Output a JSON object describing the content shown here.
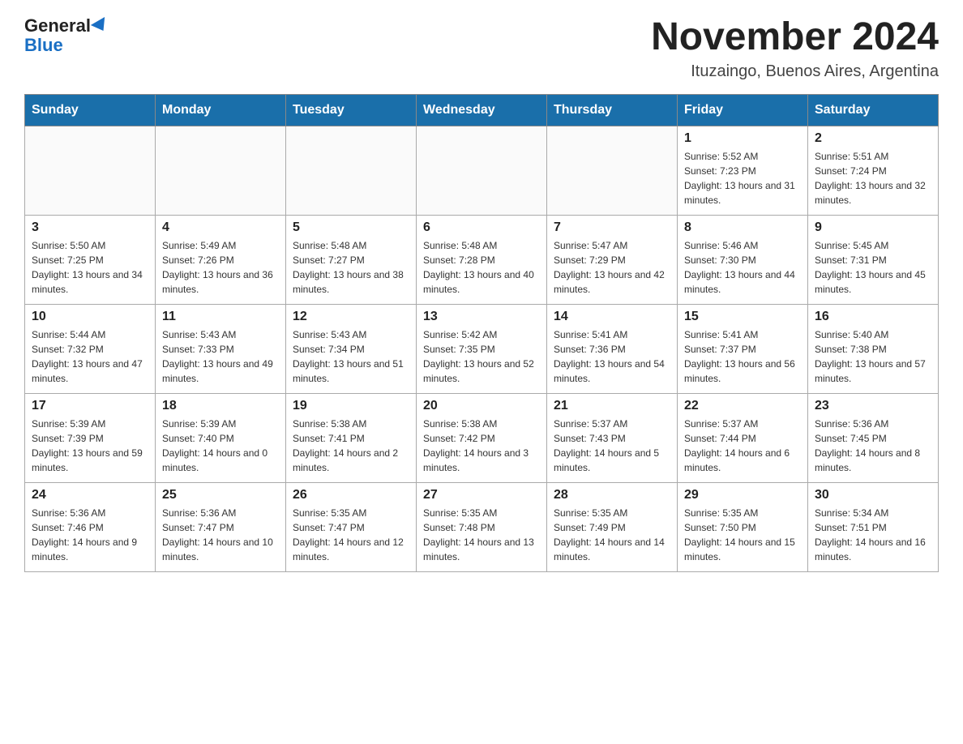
{
  "header": {
    "logo_general": "General",
    "logo_blue": "Blue",
    "title": "November 2024",
    "subtitle": "Ituzaingo, Buenos Aires, Argentina"
  },
  "weekdays": [
    "Sunday",
    "Monday",
    "Tuesday",
    "Wednesday",
    "Thursday",
    "Friday",
    "Saturday"
  ],
  "weeks": [
    [
      {
        "day": "",
        "info": ""
      },
      {
        "day": "",
        "info": ""
      },
      {
        "day": "",
        "info": ""
      },
      {
        "day": "",
        "info": ""
      },
      {
        "day": "",
        "info": ""
      },
      {
        "day": "1",
        "info": "Sunrise: 5:52 AM\nSunset: 7:23 PM\nDaylight: 13 hours and 31 minutes."
      },
      {
        "day": "2",
        "info": "Sunrise: 5:51 AM\nSunset: 7:24 PM\nDaylight: 13 hours and 32 minutes."
      }
    ],
    [
      {
        "day": "3",
        "info": "Sunrise: 5:50 AM\nSunset: 7:25 PM\nDaylight: 13 hours and 34 minutes."
      },
      {
        "day": "4",
        "info": "Sunrise: 5:49 AM\nSunset: 7:26 PM\nDaylight: 13 hours and 36 minutes."
      },
      {
        "day": "5",
        "info": "Sunrise: 5:48 AM\nSunset: 7:27 PM\nDaylight: 13 hours and 38 minutes."
      },
      {
        "day": "6",
        "info": "Sunrise: 5:48 AM\nSunset: 7:28 PM\nDaylight: 13 hours and 40 minutes."
      },
      {
        "day": "7",
        "info": "Sunrise: 5:47 AM\nSunset: 7:29 PM\nDaylight: 13 hours and 42 minutes."
      },
      {
        "day": "8",
        "info": "Sunrise: 5:46 AM\nSunset: 7:30 PM\nDaylight: 13 hours and 44 minutes."
      },
      {
        "day": "9",
        "info": "Sunrise: 5:45 AM\nSunset: 7:31 PM\nDaylight: 13 hours and 45 minutes."
      }
    ],
    [
      {
        "day": "10",
        "info": "Sunrise: 5:44 AM\nSunset: 7:32 PM\nDaylight: 13 hours and 47 minutes."
      },
      {
        "day": "11",
        "info": "Sunrise: 5:43 AM\nSunset: 7:33 PM\nDaylight: 13 hours and 49 minutes."
      },
      {
        "day": "12",
        "info": "Sunrise: 5:43 AM\nSunset: 7:34 PM\nDaylight: 13 hours and 51 minutes."
      },
      {
        "day": "13",
        "info": "Sunrise: 5:42 AM\nSunset: 7:35 PM\nDaylight: 13 hours and 52 minutes."
      },
      {
        "day": "14",
        "info": "Sunrise: 5:41 AM\nSunset: 7:36 PM\nDaylight: 13 hours and 54 minutes."
      },
      {
        "day": "15",
        "info": "Sunrise: 5:41 AM\nSunset: 7:37 PM\nDaylight: 13 hours and 56 minutes."
      },
      {
        "day": "16",
        "info": "Sunrise: 5:40 AM\nSunset: 7:38 PM\nDaylight: 13 hours and 57 minutes."
      }
    ],
    [
      {
        "day": "17",
        "info": "Sunrise: 5:39 AM\nSunset: 7:39 PM\nDaylight: 13 hours and 59 minutes."
      },
      {
        "day": "18",
        "info": "Sunrise: 5:39 AM\nSunset: 7:40 PM\nDaylight: 14 hours and 0 minutes."
      },
      {
        "day": "19",
        "info": "Sunrise: 5:38 AM\nSunset: 7:41 PM\nDaylight: 14 hours and 2 minutes."
      },
      {
        "day": "20",
        "info": "Sunrise: 5:38 AM\nSunset: 7:42 PM\nDaylight: 14 hours and 3 minutes."
      },
      {
        "day": "21",
        "info": "Sunrise: 5:37 AM\nSunset: 7:43 PM\nDaylight: 14 hours and 5 minutes."
      },
      {
        "day": "22",
        "info": "Sunrise: 5:37 AM\nSunset: 7:44 PM\nDaylight: 14 hours and 6 minutes."
      },
      {
        "day": "23",
        "info": "Sunrise: 5:36 AM\nSunset: 7:45 PM\nDaylight: 14 hours and 8 minutes."
      }
    ],
    [
      {
        "day": "24",
        "info": "Sunrise: 5:36 AM\nSunset: 7:46 PM\nDaylight: 14 hours and 9 minutes."
      },
      {
        "day": "25",
        "info": "Sunrise: 5:36 AM\nSunset: 7:47 PM\nDaylight: 14 hours and 10 minutes."
      },
      {
        "day": "26",
        "info": "Sunrise: 5:35 AM\nSunset: 7:47 PM\nDaylight: 14 hours and 12 minutes."
      },
      {
        "day": "27",
        "info": "Sunrise: 5:35 AM\nSunset: 7:48 PM\nDaylight: 14 hours and 13 minutes."
      },
      {
        "day": "28",
        "info": "Sunrise: 5:35 AM\nSunset: 7:49 PM\nDaylight: 14 hours and 14 minutes."
      },
      {
        "day": "29",
        "info": "Sunrise: 5:35 AM\nSunset: 7:50 PM\nDaylight: 14 hours and 15 minutes."
      },
      {
        "day": "30",
        "info": "Sunrise: 5:34 AM\nSunset: 7:51 PM\nDaylight: 14 hours and 16 minutes."
      }
    ]
  ]
}
